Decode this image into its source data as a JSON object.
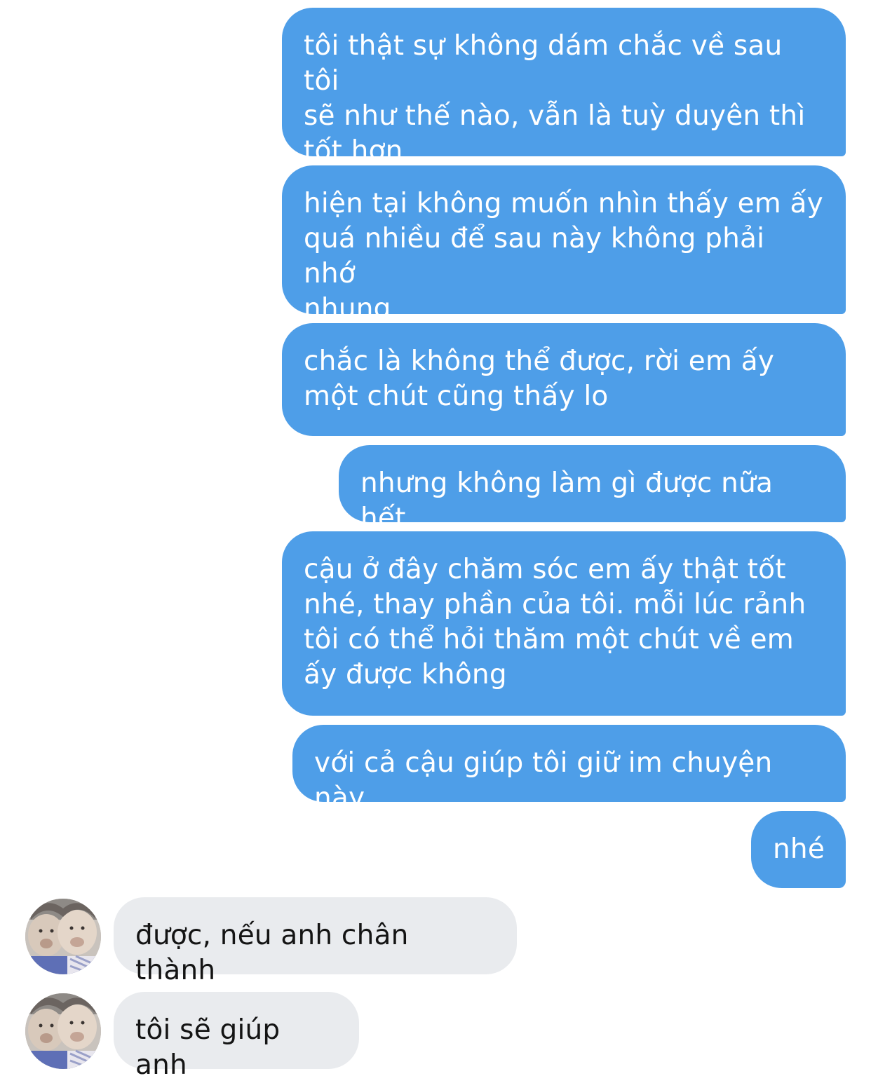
{
  "conversation": {
    "messages": [
      {
        "sender": "me",
        "text": "tôi thật sự không dám chắc về sau tôi\nsẽ như thế nào, vẫn là tuỳ duyên thì\ntốt hơn"
      },
      {
        "sender": "me",
        "text": "hiện tại không muốn nhìn thấy em ấy\nquá nhiều để sau này không phải nhớ\nnhung"
      },
      {
        "sender": "me",
        "text": "chắc là không thể được, rời em ấy\nmột chút cũng thấy lo"
      },
      {
        "sender": "me",
        "text": "nhưng không làm gì được nữa hết"
      },
      {
        "sender": "me",
        "text": "cậu ở đây chăm sóc em ấy thật tốt\nnhé, thay phần của tôi. mỗi lúc rảnh\ntôi có thể hỏi thăm một chút về em\nấy được không"
      },
      {
        "sender": "me",
        "text": "với cả cậu giúp tôi giữ im chuyện này"
      },
      {
        "sender": "me",
        "text": "nhé"
      },
      {
        "sender": "other",
        "text": "được, nếu anh chân thành"
      },
      {
        "sender": "other",
        "text": "tôi sẽ giúp anh"
      }
    ]
  },
  "colors": {
    "outgoing_bubble": "#4e9ee8",
    "incoming_bubble": "#e9ebee",
    "background": "#ffffff"
  },
  "icons": {
    "avatar": "contact-avatar-photo"
  }
}
